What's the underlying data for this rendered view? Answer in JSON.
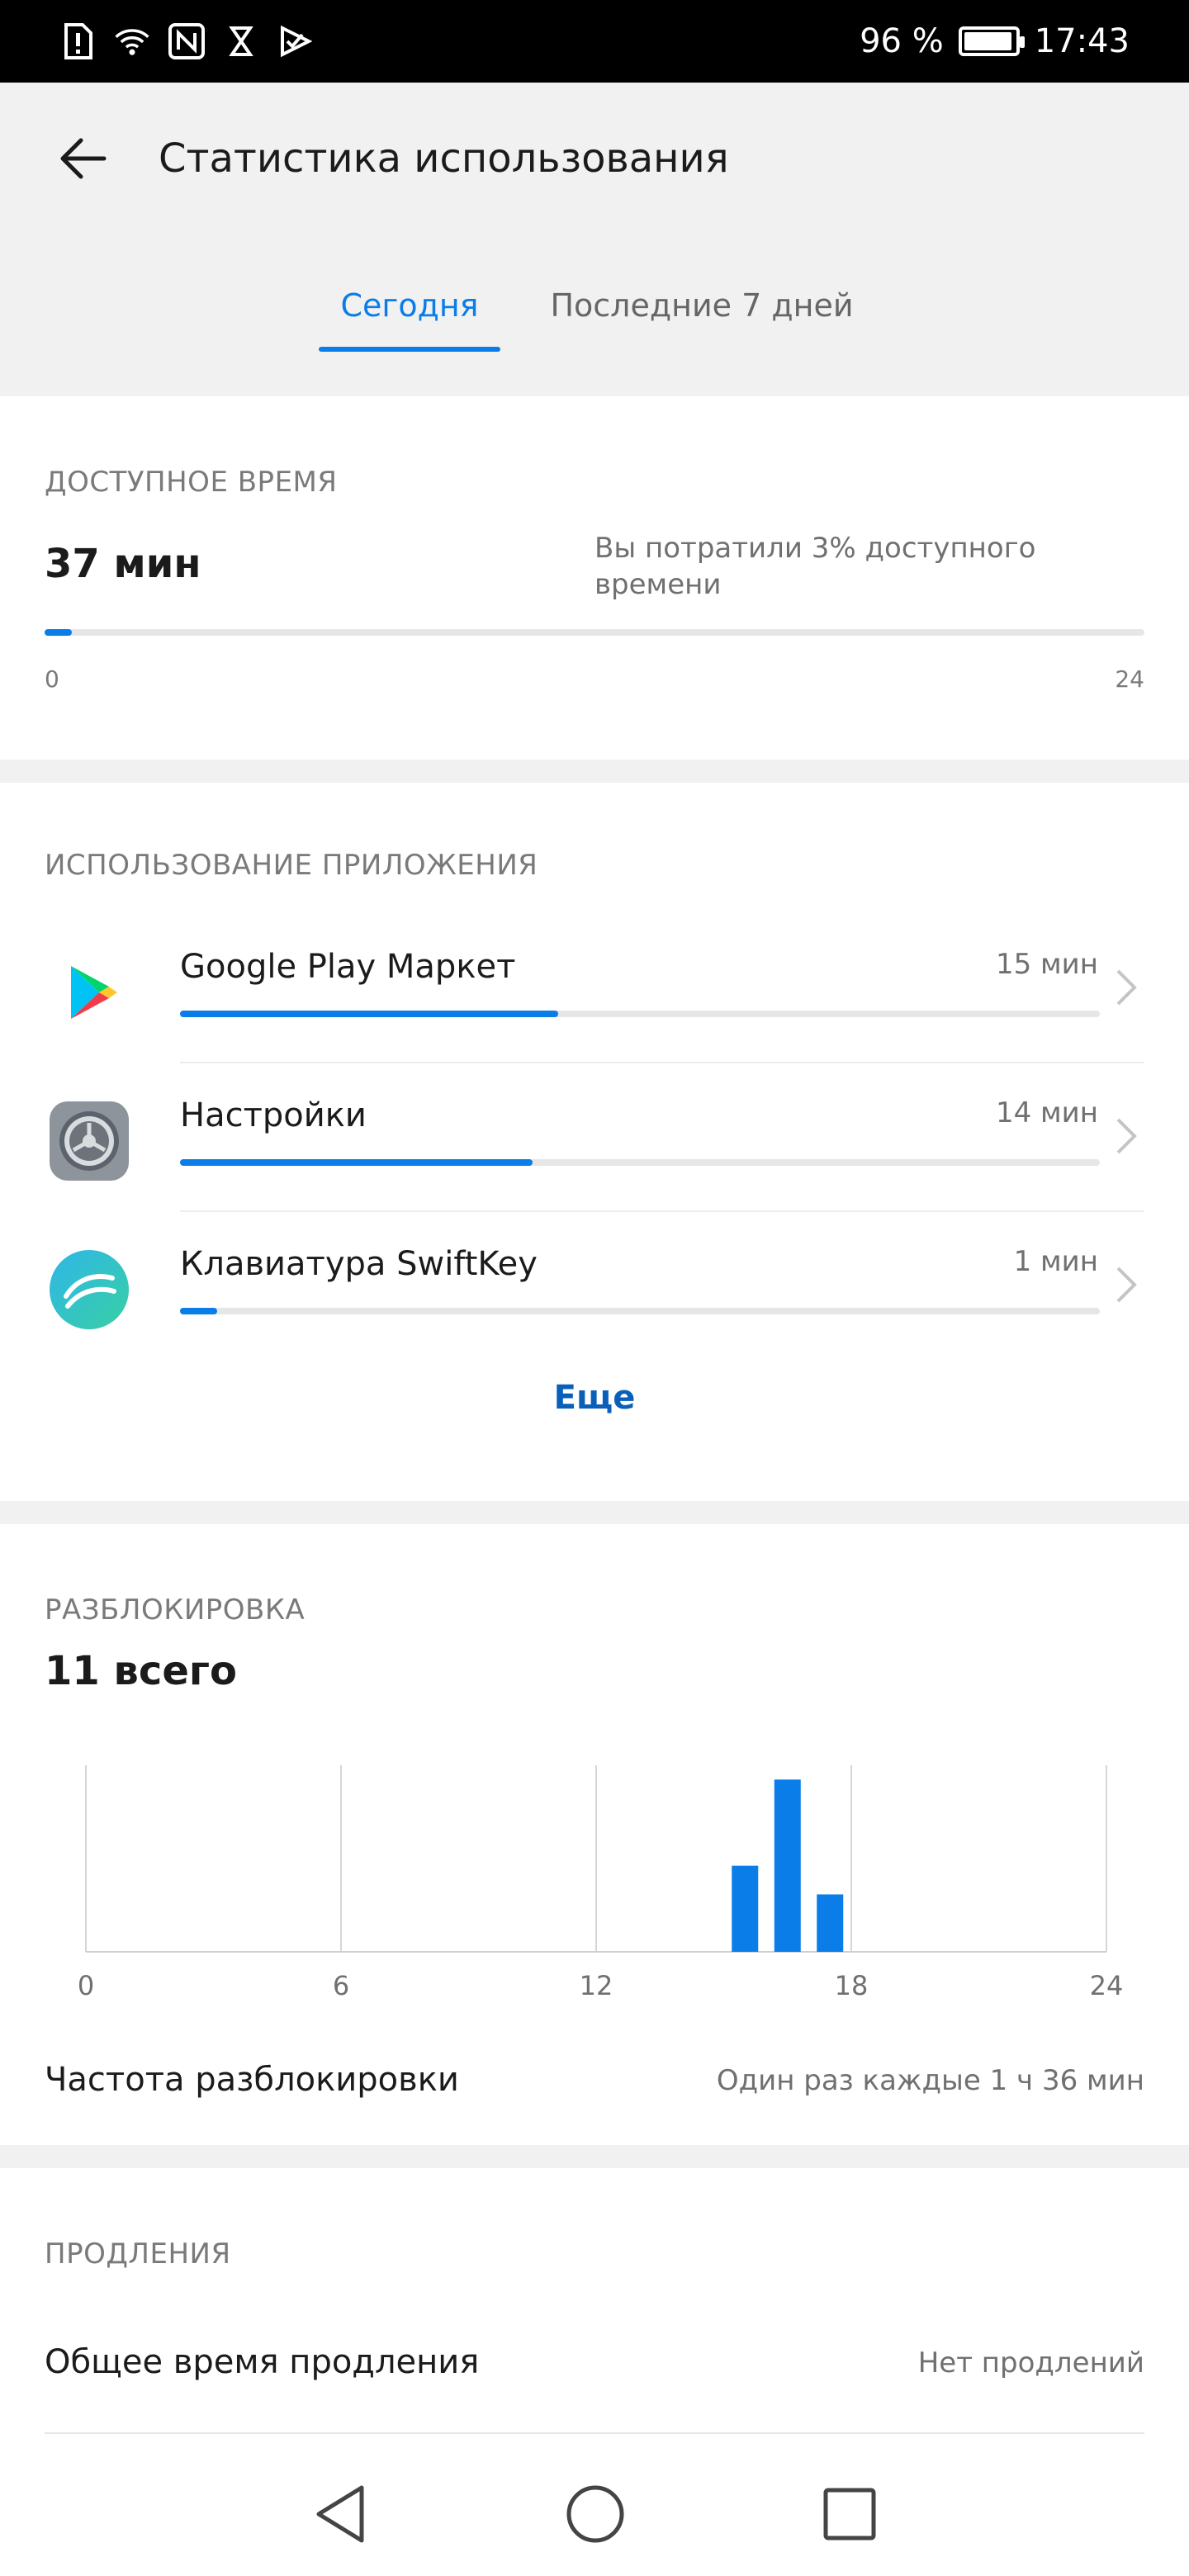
{
  "status_bar": {
    "battery_text": "96 %",
    "battery_level": 0.96,
    "time": "17:43",
    "icons": [
      "sim-alert-icon",
      "wifi-icon",
      "nfc-icon",
      "hourglass-icon",
      "play-check-icon"
    ]
  },
  "header": {
    "title": "Статистика использования",
    "back_icon": "arrow-left-icon",
    "tabs": [
      {
        "label": "Сегодня",
        "active": true
      },
      {
        "label": "Последние 7 дней",
        "active": false
      }
    ]
  },
  "available": {
    "section_title": "ДОСТУПНОЕ ВРЕМЯ",
    "value": "37 мин",
    "note": "Вы потратили 3% доступного времени",
    "progress_percent": 2.5,
    "scale_min": "0",
    "scale_max": "24"
  },
  "app_usage": {
    "section_title": "ИСПОЛЬЗОВАНИЕ ПРИЛОЖЕНИЯ",
    "apps": [
      {
        "name": "Google Play Маркет",
        "time": "15 мин",
        "minutes": 15,
        "icon": "google-play-icon"
      },
      {
        "name": "Настройки",
        "time": "14 мин",
        "minutes": 14,
        "icon": "settings-icon"
      },
      {
        "name": "Клавиатура SwiftKey",
        "time": "1 мин",
        "minutes": 1,
        "icon": "swiftkey-icon"
      }
    ],
    "more_label": "Еще"
  },
  "unlock": {
    "section_title": "РАЗБЛОКИРОВКА",
    "total": "11 всего",
    "frequency_label": "Частота разблокировки",
    "frequency_value": "Один раз каждые 1 ч 36 мин"
  },
  "chart_data": {
    "type": "bar",
    "x_ticks": [
      "0",
      "6",
      "12",
      "18",
      "24"
    ],
    "xlim": [
      0,
      24
    ],
    "bars": [
      {
        "hour": 15,
        "count": 3
      },
      {
        "hour": 16,
        "count": 6
      },
      {
        "hour": 17,
        "count": 2
      }
    ],
    "ylim": [
      0,
      6.5
    ],
    "bar_color": "#0a7de8",
    "grid": true
  },
  "extensions": {
    "section_title": "ПРОДЛЕНИЯ",
    "label": "Общее время продления",
    "value": "Нет продлений"
  },
  "colors": {
    "accent": "#0a7de8",
    "link": "#0a60b8"
  }
}
